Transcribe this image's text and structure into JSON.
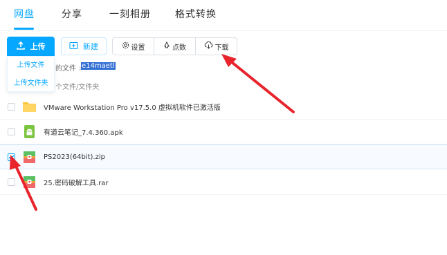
{
  "tabs": [
    {
      "label": "网盘",
      "active": true
    },
    {
      "label": "分享",
      "active": false
    },
    {
      "label": "一刻相册",
      "active": false
    },
    {
      "label": "格式转换",
      "active": false
    }
  ],
  "toolbar": {
    "upload_label": "上传",
    "new_label": "新建",
    "settings_label": "设置",
    "points_label": "点数",
    "download_label": "下载"
  },
  "upload_menu": {
    "file_label": "上传文件",
    "folder_label": "上传文件夹"
  },
  "breadcrumb": {
    "partial": "的文件",
    "separator": ">",
    "current": "e14maetl"
  },
  "count_text": "个文件/文件夹",
  "files": [
    {
      "name": "VMware Workstation Pro v17.5.0 虚拟机软件已激活版",
      "type": "folder",
      "checked": false,
      "icon": "folder-icon"
    },
    {
      "name": "有道云笔记_7.4.360.apk",
      "type": "apk",
      "checked": false,
      "icon": "android-icon"
    },
    {
      "name": "PS2023(64bit).zip",
      "type": "zip",
      "checked": true,
      "icon": "archive-icon"
    },
    {
      "name": "25.密码破解工具.rar",
      "type": "rar",
      "checked": false,
      "icon": "archive-icon"
    }
  ],
  "colors": {
    "accent": "#06a7ff",
    "annotation": "#e8232c",
    "selection": "#3470d4"
  }
}
